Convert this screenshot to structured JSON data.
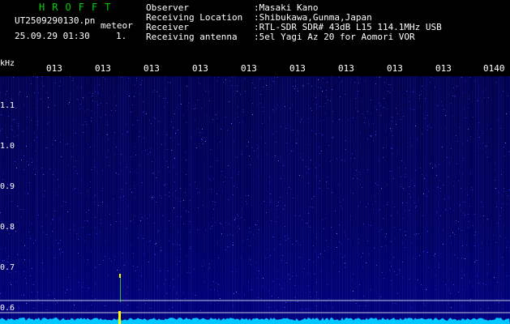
{
  "header": {
    "brand": "HROFFT",
    "filename": "UT2509290130.pn",
    "tag": "meteor",
    "datetime": "25.09.29 01:30",
    "count": "1.",
    "info": [
      {
        "key": "Observer",
        "value": ":Masaki Kano"
      },
      {
        "key": "Receiving Location",
        "value": ":Shibukawa,Gunma,Japan"
      },
      {
        "key": "Receiver",
        "value": ":RTL-SDR SDR# 43dB L15 114.1MHz USB"
      },
      {
        "key": "Receiving antenna",
        "value": ":5el Yagi Az 20 for Aomori VOR"
      }
    ]
  },
  "axis": {
    "unit": "kHz",
    "x_ticks": [
      "013",
      "013",
      "013",
      "013",
      "013",
      "013",
      "013",
      "013",
      "013",
      "0140"
    ],
    "y_ticks": [
      "1.1",
      "1.0",
      "0.9",
      "0.8",
      "0.7",
      "0.6"
    ]
  },
  "colors": {
    "background": "#000000",
    "waterfall": "#00005c",
    "noise_floor": "#00c8ff",
    "signal": "#ffff00",
    "brand": "#00d200"
  }
}
